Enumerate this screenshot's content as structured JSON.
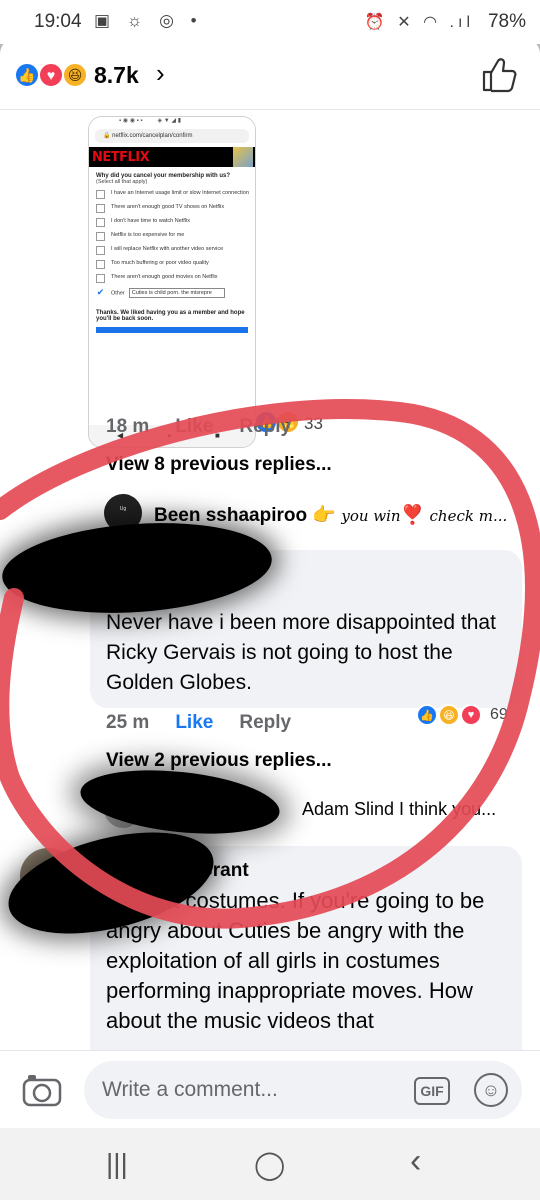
{
  "status_bar": {
    "time": "19:04",
    "battery": "78%",
    "left_icons": "▣ ☼ ◎ •",
    "right_icons": "⏰ ✕ ◠ .ıl"
  },
  "reactions_header": {
    "count": "8.7k",
    "chevron": "›"
  },
  "embedded_screenshot": {
    "url": "netflix.com/cancelplan/confirm",
    "logo": "NETFLIX",
    "question": "Why did you cancel your membership with us?",
    "sub": "(Select all that apply)",
    "options": [
      "I have an Internet usage limit or slow Internet connection",
      "There aren't enough good TV shows on Netflix",
      "I don't have time to watch Netflix",
      "Netflix is too expensive for me",
      "I will replace Netflix with another video service",
      "Too much buffering or poor video quality",
      "There aren't enough good movies on Netflix"
    ],
    "other_label": "Other",
    "other_value": "Cuties is child porn. the misrepre",
    "thanks": "Thanks. We liked having you as a member and hope you'll be back soon."
  },
  "post_reactions": {
    "count": "33"
  },
  "first_meta": {
    "time": "18 m",
    "like": "Like",
    "reply": "Reply"
  },
  "view_previous_1": "View 8 previous replies...",
  "reply_preview_1": {
    "name": "Been sshaapiroo",
    "emoji": "👉",
    "text": "you win",
    "heart": "❣️",
    "more": "check m..."
  },
  "comment_1": {
    "body": "Never have i been more disappointed that Ricky Gervais is not going to host the Golden Globes.",
    "reactions": "69",
    "time": "25 m",
    "like": "Like",
    "reply": "Reply"
  },
  "view_previous_2": "View 2 previous replies...",
  "reply_preview_2": {
    "text": "Adam Slind I think you..."
  },
  "comment_2": {
    "name": "Grant",
    "body": "Current costumes. If you're going to be angry about Cuties be angry with the exploitation of all girls in costumes performing inappropriate moves. How about the music videos that"
  },
  "composer": {
    "placeholder": "Write a comment...",
    "gif": "GIF"
  },
  "nav": {
    "recents": "|||",
    "home": "◯",
    "back": "‹"
  }
}
